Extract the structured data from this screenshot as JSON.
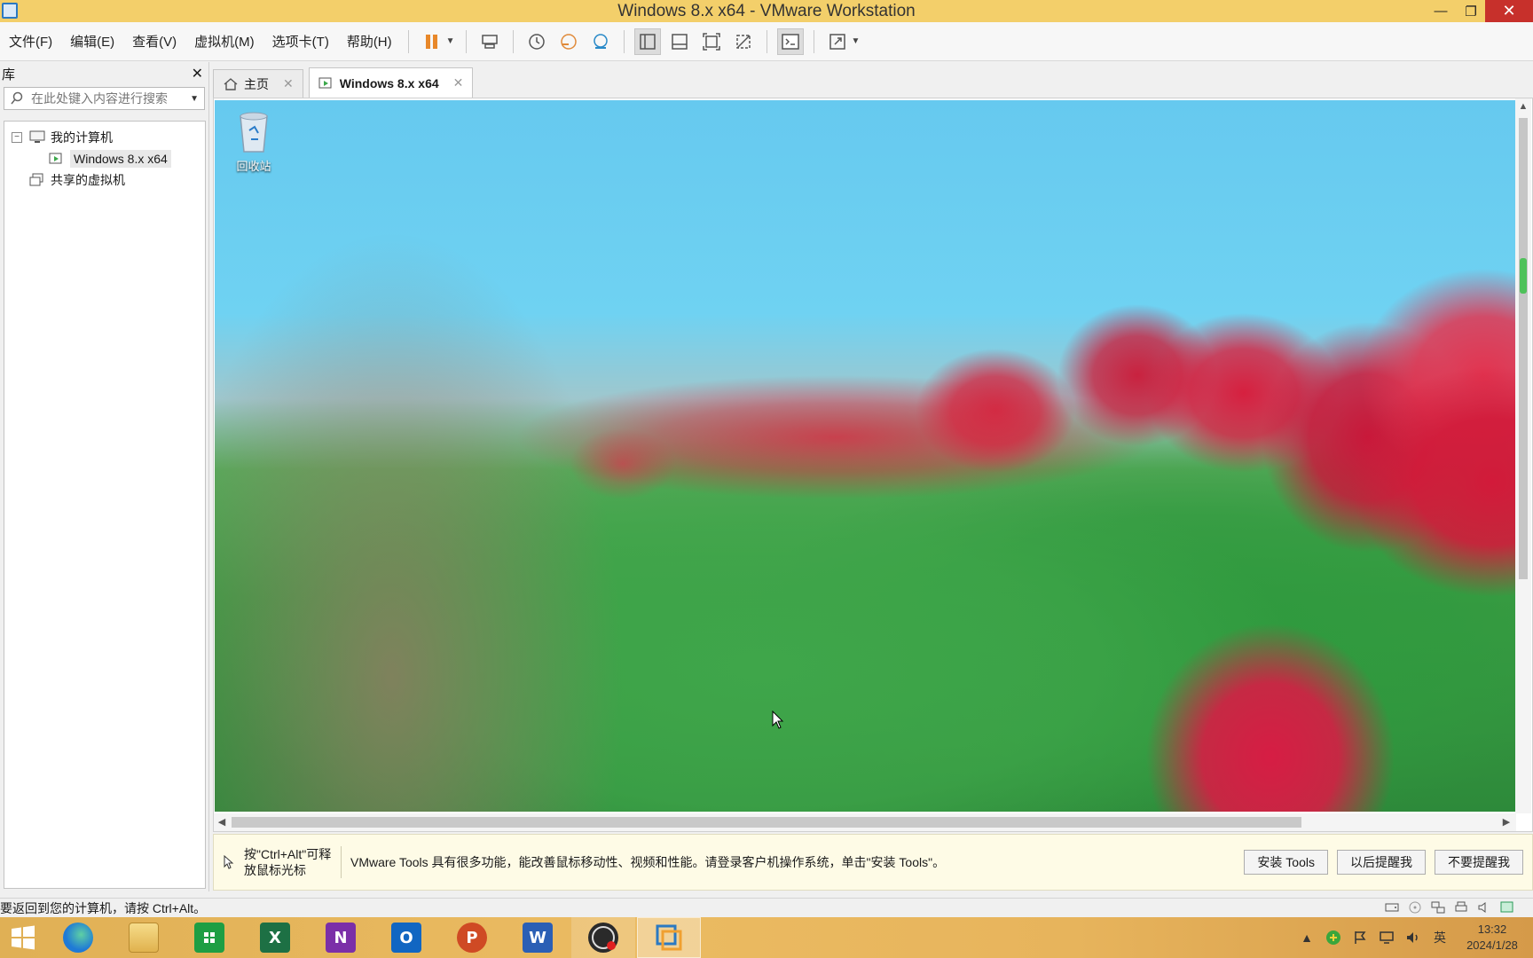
{
  "window": {
    "title": "Windows 8.x x64 - VMware Workstation"
  },
  "menu": [
    "文件(F)",
    "编辑(E)",
    "查看(V)",
    "虚拟机(M)",
    "选项卡(T)",
    "帮助(H)"
  ],
  "library": {
    "title": "库",
    "search_placeholder": "在此处键入内容进行搜索",
    "tree": {
      "root": "我的计算机",
      "vm": "Windows 8.x x64",
      "shared": "共享的虚拟机"
    }
  },
  "tabs": [
    {
      "label": "主页"
    },
    {
      "label": "Windows 8.x x64"
    }
  ],
  "guest": {
    "recycle_bin": "回收站"
  },
  "notify": {
    "hint_line1": "按\"Ctrl+Alt\"可释",
    "hint_line2": "放鼠标光标",
    "message": "VMware Tools 具有很多功能，能改善鼠标移动性、视频和性能。请登录客户机操作系统，单击\"安装 Tools\"。",
    "install": "安装 Tools",
    "remind_later": "以后提醒我",
    "never_remind": "不要提醒我"
  },
  "status": {
    "text": "要返回到您的计算机，请按 Ctrl+Alt。"
  },
  "taskbar": {
    "apps": [
      {
        "name": "edge",
        "letter": "",
        "color": "#1f7ad6"
      },
      {
        "name": "explorer",
        "letter": "",
        "color": "#e8c46a"
      },
      {
        "name": "store",
        "letter": "",
        "color": "#1e9e43"
      },
      {
        "name": "excel",
        "letter": "X",
        "color": "#1d7044"
      },
      {
        "name": "onenote",
        "letter": "N",
        "color": "#7b2fa8"
      },
      {
        "name": "outlook",
        "letter": "O",
        "color": "#1166c2"
      },
      {
        "name": "powerpoint",
        "letter": "P",
        "color": "#cf4a24"
      },
      {
        "name": "word",
        "letter": "W",
        "color": "#2b5fb5"
      }
    ],
    "tray_lang": "英",
    "time": "13:32",
    "date": "2024/1/28"
  }
}
